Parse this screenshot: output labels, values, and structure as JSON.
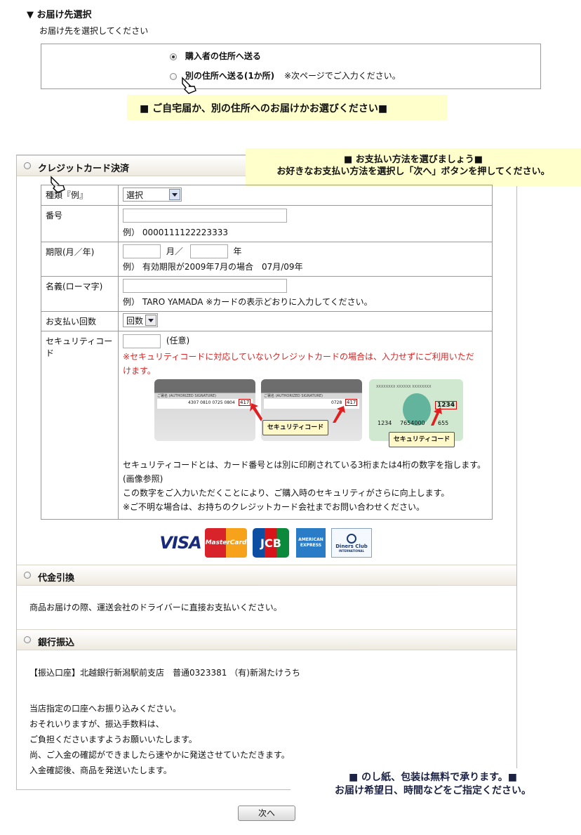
{
  "delivery": {
    "title": "▼ お届け先選択",
    "subtitle": "お届け先を選択してください",
    "option_buyer": "購入者の住所へ送る",
    "option_other": "別の住所へ送る(1か所)",
    "option_other_note": "※次ページでご入力ください。",
    "note": "■ ご自宅届か、別の住所へのお届けかお選びください■"
  },
  "payment_note": {
    "line1": "■ お支払い方法を選びましょう■",
    "line2": "お好きなお支払い方法を選択し「次へ」ボタンを押してください。"
  },
  "credit": {
    "header": "クレジットカード決済",
    "type_label": "種類『例』",
    "type_value": "選択",
    "number_label": "番号",
    "number_example": "例） 0000111122223333",
    "expiry_label": "期限(月／年)",
    "expiry_month_unit": "月／",
    "expiry_year_unit": "年",
    "expiry_example": "例） 有効期限が2009年7月の場合　07月/09年",
    "name_label": "名義(ローマ字)",
    "name_example": "例） TARO YAMADA ※カードの表示どおりに入力してください。",
    "installments_label": "お支払い回数",
    "installments_value": "回数",
    "security_label": "セキュリティコード",
    "security_optional": "(任意)",
    "security_warning": "※セキュリティコードに対応していないクレジットカードの場合は、入力せずにご利用いただけます。",
    "card1_sig": "ご署名 (AUTHORIZED SIGNATURE)",
    "card1_digits": "4307 0810 0725 0804",
    "card1_code": "417",
    "card2_sig": "ご署名 (AUTHORIZED SIGNATURE)",
    "card2_digits": "0728",
    "card2_code": "417",
    "card3_top": "XXXXXXXX XXXXXX XXXXXXXX",
    "card3_code": "1234",
    "card3_num1": "1234",
    "card3_num2": "7654000",
    "card3_num3": "655",
    "sc_tag": "セキュリティコード",
    "security_desc1": "セキュリティコードとは、カード番号とは別に印刷されている3桁または4桁の数字を指します。(画像参照)",
    "security_desc2": "この数字をご入力いただくことにより、ご購入時のセキュリティがさらに向上します。",
    "security_desc3": "※ご不明な場合は、お持ちのクレジットカード会社までお問い合わせください。",
    "logos": {
      "visa": "VISA",
      "mastercard": "MasterCard",
      "jcb": "JCB",
      "amex": "AMERICAN EXPRESS",
      "diners": "Diners Club",
      "diners_sub": "INTERNATIONAL"
    }
  },
  "cod": {
    "header": "代金引換",
    "text": "商品お届けの際、運送会社のドライバーに直接お支払いください。"
  },
  "bank": {
    "header": "銀行振込",
    "account": "【振込口座】北越銀行新潟駅前支店　普通0323381 （有)新潟たけうち",
    "l1": "当店指定の口座へお振り込みください。",
    "l2": "おそれいりますが、振込手数料は、",
    "l3": "ご負担くださいますようお願いいたします。",
    "l4": "尚、ご入金の確認ができましたら速やかに発送させていただきます。",
    "l5": "入金確認後、商品を発送いたします。"
  },
  "bottom_note": {
    "line1": "■ のし紙、包装は無料で承ります。■",
    "line2": "お届け希望日、時間などをご指定ください。"
  },
  "next_button": "次へ"
}
